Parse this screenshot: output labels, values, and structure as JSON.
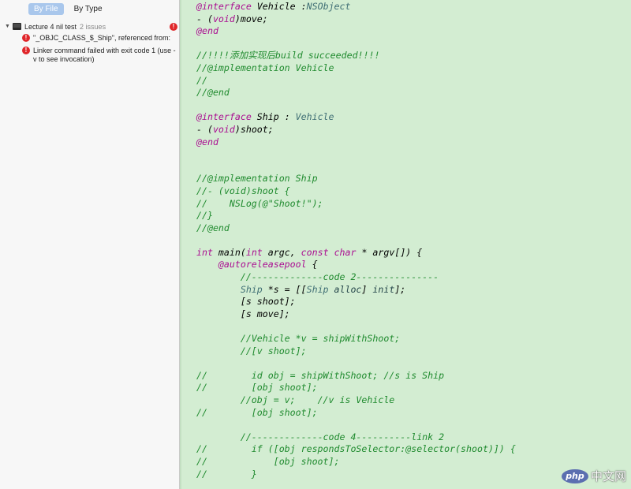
{
  "navigator": {
    "tabs": [
      {
        "label": "By File",
        "active": true
      },
      {
        "label": "By Type",
        "active": false
      }
    ],
    "project": {
      "name": "Lecture 4 nil test",
      "issue_count": "2 issues",
      "issues": [
        {
          "severity": "error",
          "text": "\"_OBJC_CLASS_$_Ship\", referenced from:"
        },
        {
          "severity": "error",
          "text": "Linker command failed with exit code 1 (use -v to see invocation)"
        }
      ]
    }
  },
  "editor": {
    "background": "#d3edd2",
    "code_lines": [
      [
        [
          "kw",
          "@interface"
        ],
        [
          "pl",
          " Vehicle :"
        ],
        [
          "ty",
          "NSObject"
        ]
      ],
      [
        [
          "pl",
          "- ("
        ],
        [
          "kw",
          "void"
        ],
        [
          "pl",
          ")move;"
        ]
      ],
      [
        [
          "kw",
          "@end"
        ]
      ],
      [],
      [
        [
          "cm",
          "//!!!!添加实现后build succeeded!!!!"
        ]
      ],
      [
        [
          "cm",
          "//@implementation Vehicle"
        ]
      ],
      [
        [
          "cm",
          "//"
        ]
      ],
      [
        [
          "cm",
          "//@end"
        ]
      ],
      [],
      [
        [
          "kw",
          "@interface"
        ],
        [
          "pl",
          " Ship : "
        ],
        [
          "ty",
          "Vehicle"
        ]
      ],
      [
        [
          "pl",
          "- ("
        ],
        [
          "kw",
          "void"
        ],
        [
          "pl",
          ")shoot;"
        ]
      ],
      [
        [
          "kw",
          "@end"
        ]
      ],
      [],
      [],
      [
        [
          "cm",
          "//@implementation Ship"
        ]
      ],
      [
        [
          "cm",
          "//- (void)shoot {"
        ]
      ],
      [
        [
          "cm",
          "//    NSLog(@\"Shoot!\");"
        ]
      ],
      [
        [
          "cm",
          "//}"
        ]
      ],
      [
        [
          "cm",
          "//@end"
        ]
      ],
      [],
      [
        [
          "kw",
          "int"
        ],
        [
          "pl",
          " main("
        ],
        [
          "kw",
          "int"
        ],
        [
          "pl",
          " argc, "
        ],
        [
          "kw",
          "const"
        ],
        [
          "pl",
          " "
        ],
        [
          "kw",
          "char"
        ],
        [
          "pl",
          " * argv[]) {"
        ]
      ],
      [
        [
          "pl",
          "    "
        ],
        [
          "kw",
          "@autoreleasepool"
        ],
        [
          "pl",
          " {"
        ]
      ],
      [
        [
          "pl",
          "        "
        ],
        [
          "cm",
          "//-------------code 2---------------"
        ]
      ],
      [
        [
          "pl",
          "        "
        ],
        [
          "ty",
          "Ship"
        ],
        [
          "pl",
          " *s = [["
        ],
        [
          "ty",
          "Ship"
        ],
        [
          "pl",
          " "
        ],
        [
          "mt",
          "alloc"
        ],
        [
          "pl",
          "] "
        ],
        [
          "mt",
          "init"
        ],
        [
          "pl",
          "];"
        ]
      ],
      [
        [
          "pl",
          "        [s shoot];"
        ]
      ],
      [
        [
          "pl",
          "        [s move];"
        ]
      ],
      [],
      [
        [
          "pl",
          "        "
        ],
        [
          "cm",
          "//Vehicle *v = shipWithShoot;"
        ]
      ],
      [
        [
          "pl",
          "        "
        ],
        [
          "cm",
          "//[v shoot];"
        ]
      ],
      [],
      [
        [
          "cm",
          "//        id obj = shipWithShoot; //s is Ship"
        ]
      ],
      [
        [
          "cm",
          "//        [obj shoot];"
        ]
      ],
      [
        [
          "pl",
          "        "
        ],
        [
          "cm",
          "//obj = v;    //v is Vehicle"
        ]
      ],
      [
        [
          "cm",
          "//        [obj shoot];"
        ]
      ],
      [],
      [
        [
          "pl",
          "        "
        ],
        [
          "cm",
          "//-------------code 4----------link 2"
        ]
      ],
      [
        [
          "cm",
          "//        if ([obj respondsToSelector:@selector(shoot)]) {"
        ]
      ],
      [
        [
          "cm",
          "//            [obj shoot];"
        ]
      ],
      [
        [
          "cm",
          "//        }"
        ]
      ]
    ]
  },
  "watermark": {
    "logo": "php",
    "text": "中文网"
  }
}
